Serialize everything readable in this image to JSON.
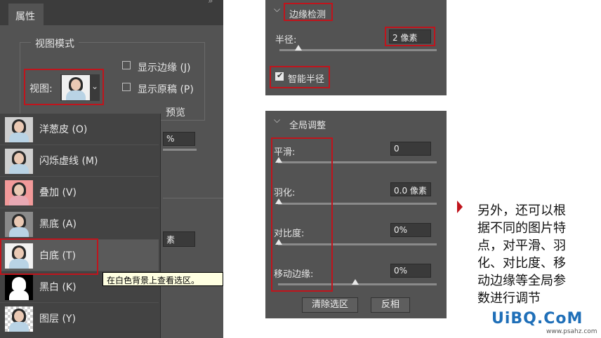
{
  "left_panel": {
    "tab": "属性",
    "group_title": "视图模式",
    "view_label": "视图:",
    "show_edge": "显示边缘 (J)",
    "show_original": "显示原稿 (P)",
    "preview_partial": "预览",
    "percent_partial": "%",
    "pixel_partial": "素",
    "menu_items": [
      {
        "label": "洋葱皮 (O)",
        "swatch": "#c8c8c8"
      },
      {
        "label": "闪烁虚线 (M)",
        "swatch": "#c8c8c8"
      },
      {
        "label": "叠加 (V)",
        "swatch": "#f29a9a"
      },
      {
        "label": "黑底 (A)",
        "swatch": "#9a9a9a"
      },
      {
        "label": "白底 (T)",
        "swatch": "#e8e8e8"
      },
      {
        "label": "黑白 (K)",
        "swatch": "#000000"
      },
      {
        "label": "图层 (Y)",
        "swatch": "#d8d8d8"
      }
    ],
    "tooltip": "在白色背景上查看选区。"
  },
  "edge_panel": {
    "title": "边缘检测",
    "radius_label": "半径:",
    "radius_value": "2 像素",
    "smart_radius": "智能半径",
    "radius_level": 0.12
  },
  "global_panel": {
    "title": "全局调整",
    "smooth_label": "平滑:",
    "smooth_value": "0",
    "feather_label": "羽化:",
    "feather_value": "0.0 像素",
    "contrast_label": "对比度:",
    "contrast_value": "0%",
    "shift_label": "移动边缘:",
    "shift_value": "0%",
    "clear_button": "清除选区",
    "invert_button": "反相"
  },
  "annotation": {
    "text_lines": [
      "另外，还可以根",
      "据不同的图片特",
      "点，对平滑、羽",
      "化、对比度、移",
      "动边缘等全局参",
      "数进行调节"
    ],
    "accent": "#c0141c"
  },
  "watermark": {
    "logo": "UiBQ.CoM",
    "url": "www.psahz.com"
  }
}
